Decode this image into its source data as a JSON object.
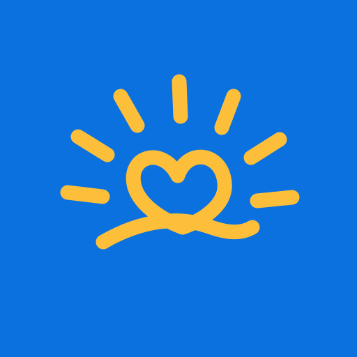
{
  "app_icon": {
    "background_color": "#0A71DF",
    "logo": {
      "icon": "sun-heart-wave-icon",
      "color": "#FDBF3A",
      "parts": [
        "sun-rays",
        "heart",
        "wave"
      ]
    }
  }
}
